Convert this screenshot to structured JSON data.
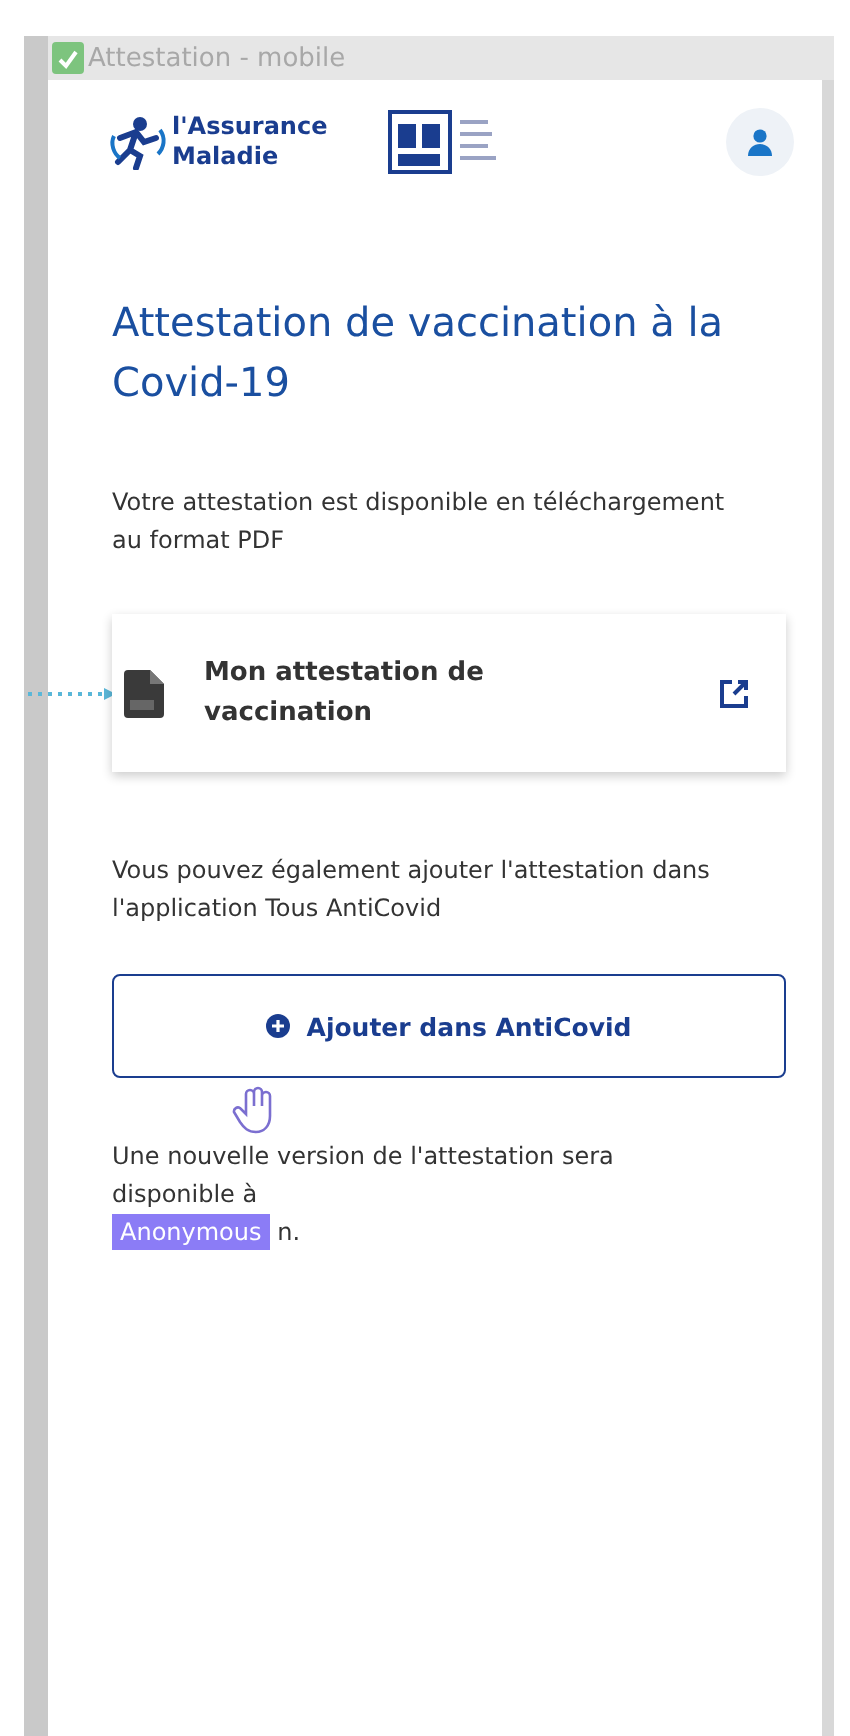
{
  "window": {
    "title": "Attestation - mobile"
  },
  "header": {
    "logo_text": "l'Assurance Maladie"
  },
  "heading": "Attestation de vaccination à la Covid-19",
  "intro": "Votre attestation est disponible en téléchargement au format PDF",
  "document_card": {
    "label": "Mon attestation de vaccination"
  },
  "anticovid_note": "Vous pouvez également ajouter l'attestation dans l'application Tous AntiCovid",
  "add_button": {
    "label": "Ajouter dans AntiCovid"
  },
  "footer_note": {
    "text_before": "Une nouvelle version de l'attestation sera disponible à",
    "text_after": "n."
  },
  "cursor": {
    "user": "Anonymous"
  }
}
